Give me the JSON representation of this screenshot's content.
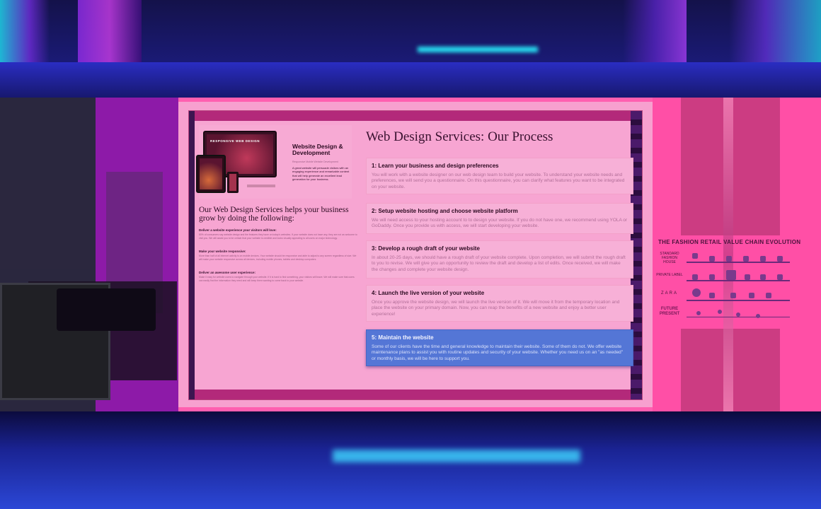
{
  "promo": {
    "screen_text": "RESPONSIVE WEB DESIGN",
    "title": "Website Design & Development",
    "subtitle": "Responsive Mobile Website Development",
    "text": "A great website will persuade visitors with an engaging experience and remarkable content that will help generate an excellent lead generation for your business."
  },
  "help": {
    "heading": "Our Web Design Services helps your business grow by doing the following:",
    "items": [
      {
        "title": "Deliver a website experience your visitors will love:",
        "text": "80% of consumers say website design and the features they have on today's websites. If your website does not have any, they are not as welcome to visit you. We will assist you to be certain that your website is credible and looks visually appealing to all users on major technology."
      },
      {
        "title": "Make your website responsive:",
        "text": "More than half of all internet activity is on mobile devices. Your website should be responsive and able to adjust to any screen regardless of size. We will make your website responsive across all devices, including mobile phones, tablets and desktop computers."
      },
      {
        "title": "Deliver an awesome user experience:",
        "text": "Make it easy for website users to navigate through your website. If it is hard to find something, your visitors will leave. We will make sure that users can easily find the information they need and will keep them wanting to come back to your website."
      }
    ]
  },
  "process": {
    "title": "Web Design Services: Our Process",
    "steps": [
      {
        "title": "1: Learn your business and design preferences",
        "body": "You will work with a website designer on our web design team to build your website. To understand your website needs and preferences, we will send you a questionnaire. On this questionnaire, you can clarify what features you want to be integrated on your website."
      },
      {
        "title": "2: Setup website hosting and choose website platform",
        "body": "We will need access to your hosting account to to design your website. If you do not have one, we recommend using YOLA or GoDaddy. Once you provide us with access, we will start developing your website."
      },
      {
        "title": "3: Develop a rough draft of your website",
        "body": "In about 20-25 days, we should have a rough draft of your website complete. Upon completion, we will submit the rough draft to you to revise. We will give you an opportunity to review the draft and develop a list of edits. Once received, we will make the changes and complete your website design."
      },
      {
        "title": "4: Launch the live version of your website",
        "body": "Once you approve the website design, we will launch the live version of it. We will move it from the temporary location and place the website on your primary domain. Now, you can reap the benefits of a new website and enjoy a better user experience!"
      },
      {
        "title": "5: Maintain the website",
        "body": "Some of our clients have the time and general knowledge to maintain their website. Some of them do not. We offer website maintenance plans to assist you with routine updates and security of your website. Whether you need us on an \"as needed\" or monthly basis, we will be here to support you."
      }
    ]
  },
  "infographic": {
    "title": "THE FASHION RETAIL VALUE CHAIN EVOLUTION",
    "rows": [
      "STANDARD FASHION HOUSE",
      "PRIVATE LABEL",
      "ZARA",
      "FUTURE PRESENT"
    ]
  },
  "colors": {
    "accent": "#5476d6",
    "overlay": "#f7a0cf",
    "frame_bar": "#b3297a"
  }
}
